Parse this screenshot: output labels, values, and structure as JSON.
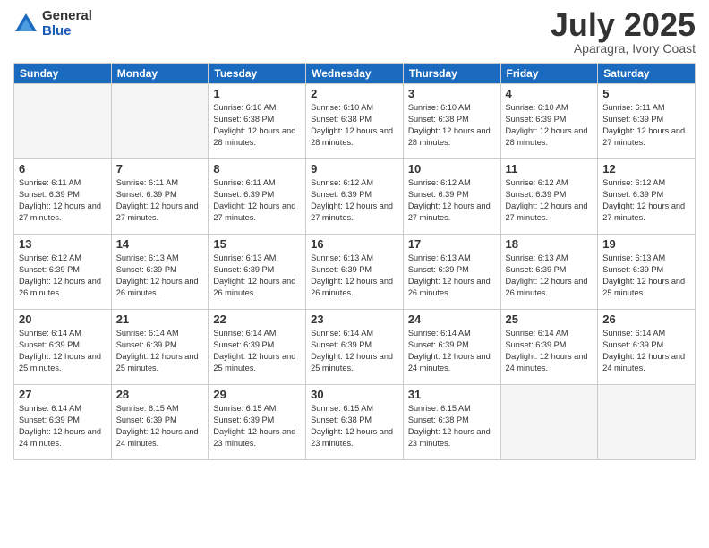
{
  "logo": {
    "general": "General",
    "blue": "Blue"
  },
  "header": {
    "month": "July 2025",
    "location": "Aparagra, Ivory Coast"
  },
  "weekdays": [
    "Sunday",
    "Monday",
    "Tuesday",
    "Wednesday",
    "Thursday",
    "Friday",
    "Saturday"
  ],
  "weeks": [
    [
      {
        "day": "",
        "info": ""
      },
      {
        "day": "",
        "info": ""
      },
      {
        "day": "1",
        "info": "Sunrise: 6:10 AM\nSunset: 6:38 PM\nDaylight: 12 hours and 28 minutes."
      },
      {
        "day": "2",
        "info": "Sunrise: 6:10 AM\nSunset: 6:38 PM\nDaylight: 12 hours and 28 minutes."
      },
      {
        "day": "3",
        "info": "Sunrise: 6:10 AM\nSunset: 6:38 PM\nDaylight: 12 hours and 28 minutes."
      },
      {
        "day": "4",
        "info": "Sunrise: 6:10 AM\nSunset: 6:39 PM\nDaylight: 12 hours and 28 minutes."
      },
      {
        "day": "5",
        "info": "Sunrise: 6:11 AM\nSunset: 6:39 PM\nDaylight: 12 hours and 27 minutes."
      }
    ],
    [
      {
        "day": "6",
        "info": "Sunrise: 6:11 AM\nSunset: 6:39 PM\nDaylight: 12 hours and 27 minutes."
      },
      {
        "day": "7",
        "info": "Sunrise: 6:11 AM\nSunset: 6:39 PM\nDaylight: 12 hours and 27 minutes."
      },
      {
        "day": "8",
        "info": "Sunrise: 6:11 AM\nSunset: 6:39 PM\nDaylight: 12 hours and 27 minutes."
      },
      {
        "day": "9",
        "info": "Sunrise: 6:12 AM\nSunset: 6:39 PM\nDaylight: 12 hours and 27 minutes."
      },
      {
        "day": "10",
        "info": "Sunrise: 6:12 AM\nSunset: 6:39 PM\nDaylight: 12 hours and 27 minutes."
      },
      {
        "day": "11",
        "info": "Sunrise: 6:12 AM\nSunset: 6:39 PM\nDaylight: 12 hours and 27 minutes."
      },
      {
        "day": "12",
        "info": "Sunrise: 6:12 AM\nSunset: 6:39 PM\nDaylight: 12 hours and 27 minutes."
      }
    ],
    [
      {
        "day": "13",
        "info": "Sunrise: 6:12 AM\nSunset: 6:39 PM\nDaylight: 12 hours and 26 minutes."
      },
      {
        "day": "14",
        "info": "Sunrise: 6:13 AM\nSunset: 6:39 PM\nDaylight: 12 hours and 26 minutes."
      },
      {
        "day": "15",
        "info": "Sunrise: 6:13 AM\nSunset: 6:39 PM\nDaylight: 12 hours and 26 minutes."
      },
      {
        "day": "16",
        "info": "Sunrise: 6:13 AM\nSunset: 6:39 PM\nDaylight: 12 hours and 26 minutes."
      },
      {
        "day": "17",
        "info": "Sunrise: 6:13 AM\nSunset: 6:39 PM\nDaylight: 12 hours and 26 minutes."
      },
      {
        "day": "18",
        "info": "Sunrise: 6:13 AM\nSunset: 6:39 PM\nDaylight: 12 hours and 26 minutes."
      },
      {
        "day": "19",
        "info": "Sunrise: 6:13 AM\nSunset: 6:39 PM\nDaylight: 12 hours and 25 minutes."
      }
    ],
    [
      {
        "day": "20",
        "info": "Sunrise: 6:14 AM\nSunset: 6:39 PM\nDaylight: 12 hours and 25 minutes."
      },
      {
        "day": "21",
        "info": "Sunrise: 6:14 AM\nSunset: 6:39 PM\nDaylight: 12 hours and 25 minutes."
      },
      {
        "day": "22",
        "info": "Sunrise: 6:14 AM\nSunset: 6:39 PM\nDaylight: 12 hours and 25 minutes."
      },
      {
        "day": "23",
        "info": "Sunrise: 6:14 AM\nSunset: 6:39 PM\nDaylight: 12 hours and 25 minutes."
      },
      {
        "day": "24",
        "info": "Sunrise: 6:14 AM\nSunset: 6:39 PM\nDaylight: 12 hours and 24 minutes."
      },
      {
        "day": "25",
        "info": "Sunrise: 6:14 AM\nSunset: 6:39 PM\nDaylight: 12 hours and 24 minutes."
      },
      {
        "day": "26",
        "info": "Sunrise: 6:14 AM\nSunset: 6:39 PM\nDaylight: 12 hours and 24 minutes."
      }
    ],
    [
      {
        "day": "27",
        "info": "Sunrise: 6:14 AM\nSunset: 6:39 PM\nDaylight: 12 hours and 24 minutes."
      },
      {
        "day": "28",
        "info": "Sunrise: 6:15 AM\nSunset: 6:39 PM\nDaylight: 12 hours and 24 minutes."
      },
      {
        "day": "29",
        "info": "Sunrise: 6:15 AM\nSunset: 6:39 PM\nDaylight: 12 hours and 23 minutes."
      },
      {
        "day": "30",
        "info": "Sunrise: 6:15 AM\nSunset: 6:38 PM\nDaylight: 12 hours and 23 minutes."
      },
      {
        "day": "31",
        "info": "Sunrise: 6:15 AM\nSunset: 6:38 PM\nDaylight: 12 hours and 23 minutes."
      },
      {
        "day": "",
        "info": ""
      },
      {
        "day": "",
        "info": ""
      }
    ]
  ]
}
